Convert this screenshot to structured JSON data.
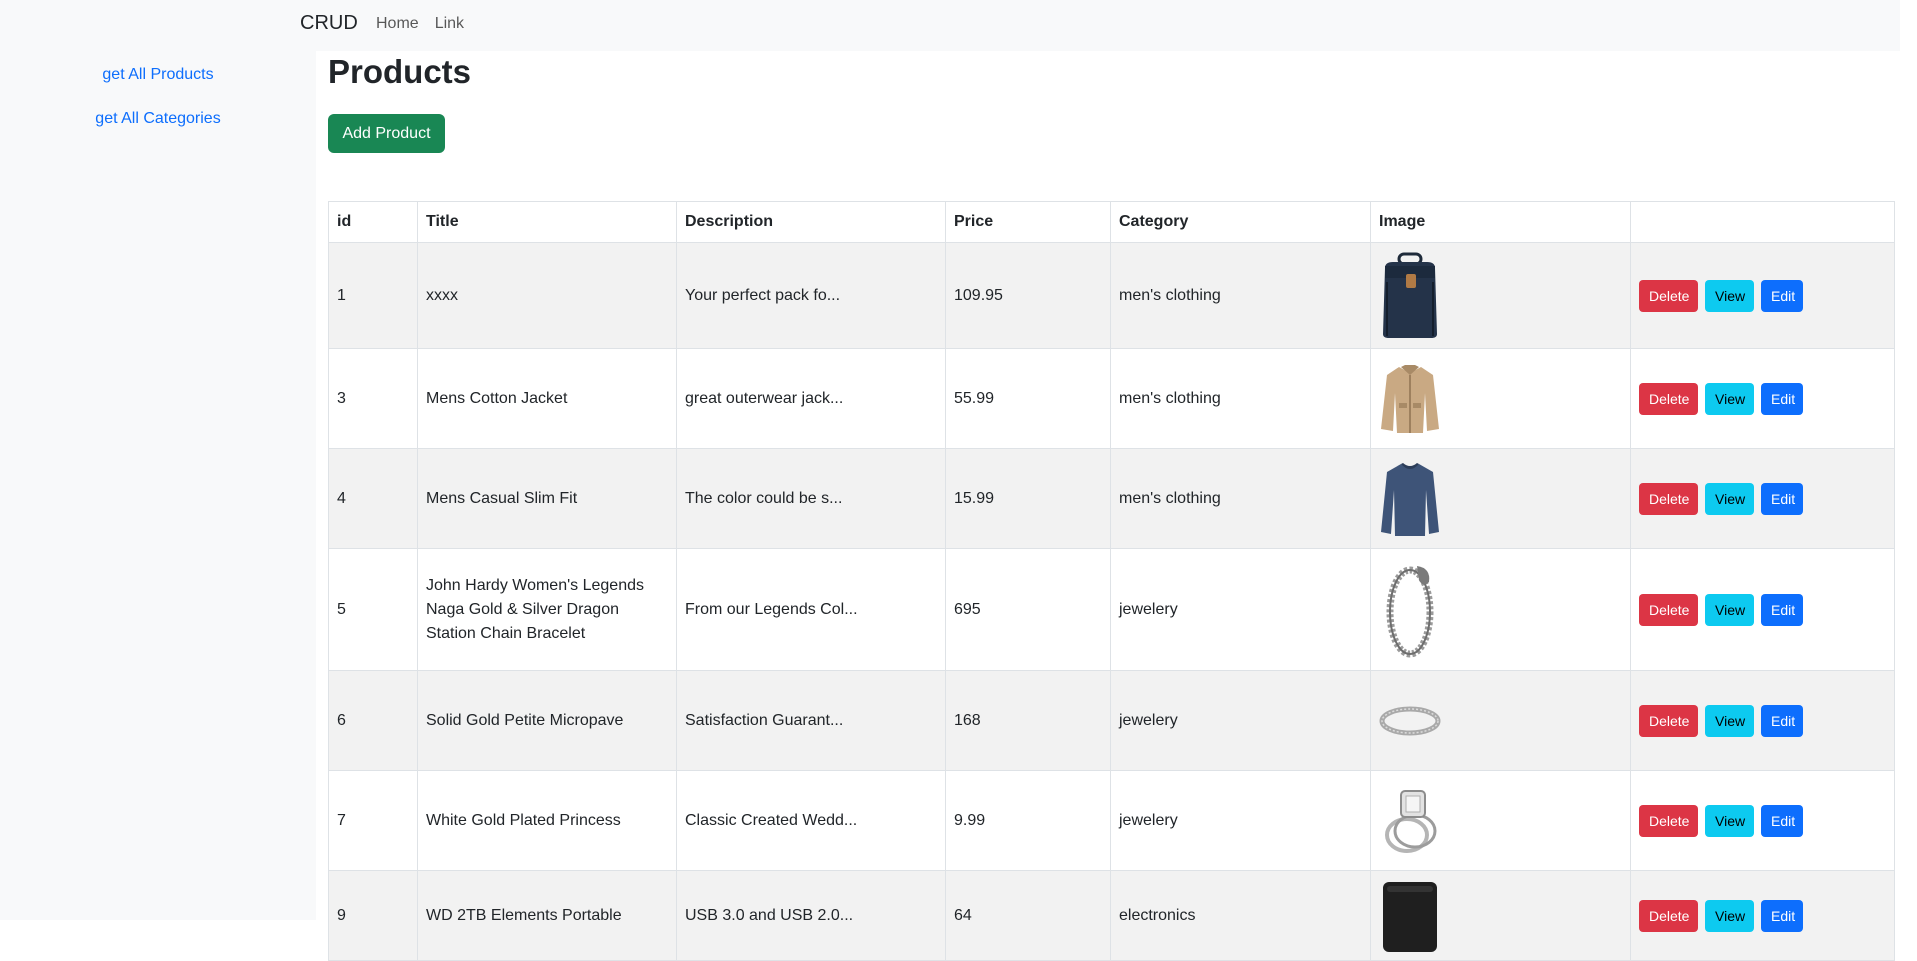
{
  "navbar": {
    "brand": "CRUD",
    "links": [
      "Home",
      "Link"
    ]
  },
  "sidebar": {
    "links": [
      "get All Products",
      "get All Categories"
    ]
  },
  "main": {
    "title": "Products",
    "add_button": "Add Product"
  },
  "table": {
    "headers": [
      "id",
      "Title",
      "Description",
      "Price",
      "Category",
      "Image",
      ""
    ],
    "rows": [
      {
        "id": "1",
        "title": "xxxx",
        "description": "Your perfect pack fo...",
        "price": "109.95",
        "category": "men's clothing",
        "image": "backpack"
      },
      {
        "id": "3",
        "title": "Mens Cotton Jacket",
        "description": "great outerwear jack...",
        "price": "55.99",
        "category": "men's clothing",
        "image": "jacket"
      },
      {
        "id": "4",
        "title": "Mens Casual Slim Fit",
        "description": "The color could be s...",
        "price": "15.99",
        "category": "men's clothing",
        "image": "shirt"
      },
      {
        "id": "5",
        "title": "John Hardy Women's Legends Naga Gold & Silver Dragon Station Chain Bracelet",
        "description": "From our Legends Col...",
        "price": "695",
        "category": "jewelery",
        "image": "bracelet"
      },
      {
        "id": "6",
        "title": "Solid Gold Petite Micropave",
        "description": "Satisfaction Guarant...",
        "price": "168",
        "category": "jewelery",
        "image": "ring-band"
      },
      {
        "id": "7",
        "title": "White Gold Plated Princess",
        "description": "Classic Created Wedd...",
        "price": "9.99",
        "category": "jewelery",
        "image": "ring-diamond"
      },
      {
        "id": "9",
        "title": "WD 2TB Elements Portable",
        "description": "USB 3.0 and USB 2.0...",
        "price": "64",
        "category": "electronics",
        "image": "hard-drive"
      }
    ],
    "actions": {
      "delete": "Delete",
      "view": "View",
      "edit": "Edit"
    }
  },
  "colors": {
    "success": "#198754",
    "danger": "#dc3545",
    "info": "#0dcaf0",
    "primary": "#0d6efd"
  }
}
